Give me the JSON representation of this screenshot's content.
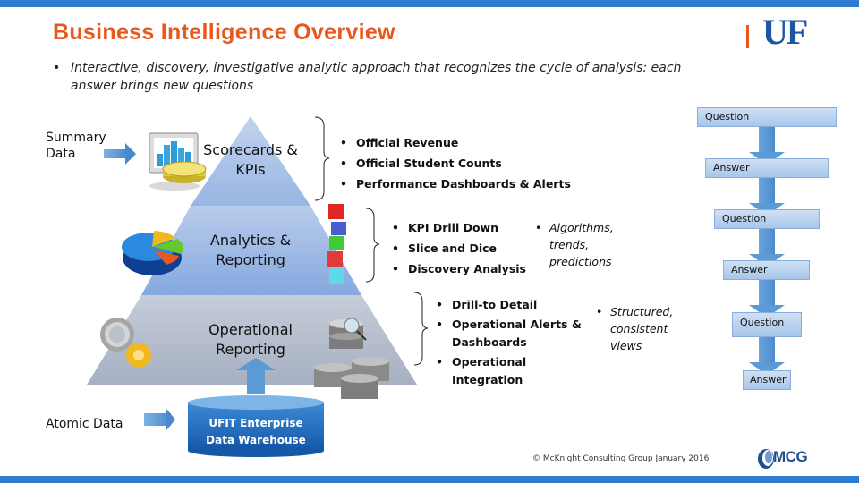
{
  "header": {
    "title": "Business Intelligence Overview",
    "logo": "UF",
    "intro_bullet": "•",
    "intro_text": "Interactive, discovery, investigative analytic approach that recognizes the cycle of analysis: each answer brings new questions"
  },
  "side_labels": {
    "summary_data": "Summary Data",
    "atomic_data": "Atomic Data"
  },
  "pyramid": {
    "tiers": [
      {
        "label_line1": "Scorecards &",
        "label_line2": "KPIs",
        "icon": "dashboard-chart-icon",
        "bullets": [
          "Official Revenue",
          "Official Student Counts",
          "Performance Dashboards & Alerts"
        ],
        "italic_note": ""
      },
      {
        "label_line1": "Analytics &",
        "label_line2": "Reporting",
        "icon": "pie-chart-icon",
        "bullets": [
          "KPI Drill Down",
          "Slice and Dice",
          "Discovery Analysis"
        ],
        "italic_note": "Algorithms, trends, predictions"
      },
      {
        "label_line1": "Operational",
        "label_line2": "Reporting",
        "icon": "gears-icon",
        "bullets": [
          "Drill-to Detail",
          "Operational Alerts & Dashboards",
          "Operational Integration"
        ],
        "italic_note": "Structured, consistent views"
      }
    ],
    "colors": {
      "top": "#a3bde3",
      "middle": "#8eaee0",
      "bottom": "#b4bdcc"
    }
  },
  "warehouse": {
    "line1": "UFIT Enterprise",
    "line2": "Data Warehouse",
    "color": "#1e6fc4"
  },
  "qa_cycle": [
    "Question",
    "Answer",
    "Question",
    "Answer",
    "Question",
    "Answer"
  ],
  "footer": {
    "copyright": "© McKnight Consulting Group January 2016",
    "logo": "MCG"
  },
  "colors": {
    "accent_orange": "#e8571b",
    "brand_blue": "#2e7bd0",
    "uf_blue": "#1f56a3",
    "arrow_blue": "#5b9bd5"
  }
}
